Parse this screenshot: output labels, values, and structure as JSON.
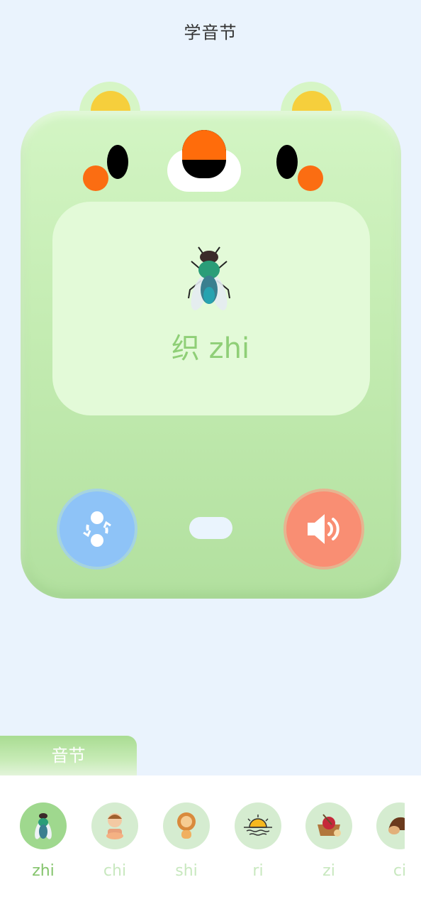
{
  "header": {
    "title": "学音节"
  },
  "card": {
    "character": "织",
    "pinyin": "zhi",
    "image_icon": "fly-icon",
    "refresh_icon": "refresh-icon",
    "sound_icon": "speaker-icon"
  },
  "tab": {
    "label": "音节"
  },
  "syllables": [
    {
      "label": "zhi",
      "icon": "fly-icon",
      "active": true
    },
    {
      "label": "chi",
      "icon": "eating-child-icon",
      "active": false
    },
    {
      "label": "shi",
      "icon": "lion-icon",
      "active": false
    },
    {
      "label": "ri",
      "icon": "sunrise-icon",
      "active": false
    },
    {
      "label": "zi",
      "icon": "yarn-basket-icon",
      "active": false
    },
    {
      "label": "ci",
      "icon": "hedgehog-icon",
      "active": false
    }
  ],
  "colors": {
    "background": "#eaf3fd",
    "card_green": "#c4ecb2",
    "accent_green": "#8fcf77",
    "refresh_blue": "#8ec3f7",
    "sound_coral": "#f98e73",
    "cheek_orange": "#fb6d12",
    "ear_yellow": "#f6cf3c"
  }
}
